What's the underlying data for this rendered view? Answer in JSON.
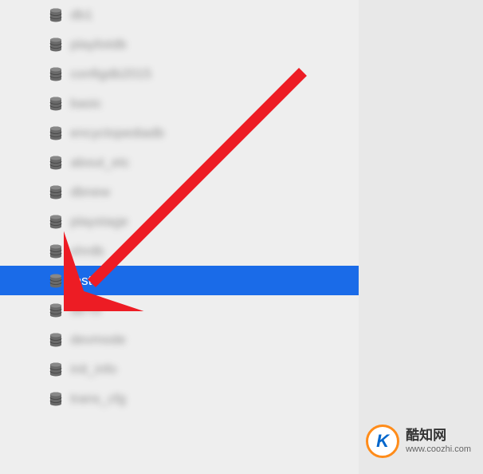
{
  "list": {
    "items": [
      {
        "label": "db1",
        "selected": false,
        "blurred": true
      },
      {
        "label": "playlistdb",
        "selected": false,
        "blurred": true
      },
      {
        "label": "configdb2015",
        "selected": false,
        "blurred": true
      },
      {
        "label": "basic",
        "selected": false,
        "blurred": true
      },
      {
        "label": "encyclopediadb",
        "selected": false,
        "blurred": true
      },
      {
        "label": "about_etc",
        "selected": false,
        "blurred": true
      },
      {
        "label": "dbnew",
        "selected": false,
        "blurred": true
      },
      {
        "label": "playstage",
        "selected": false,
        "blurred": true
      },
      {
        "label": "shrdb",
        "selected": false,
        "blurred": true
      },
      {
        "label": "test",
        "selected": true,
        "blurred": false
      },
      {
        "label": "db-f3",
        "selected": false,
        "blurred": true
      },
      {
        "label": "devmode",
        "selected": false,
        "blurred": true
      },
      {
        "label": "init_info",
        "selected": false,
        "blurred": true
      },
      {
        "label": "trans_cfg",
        "selected": false,
        "blurred": true
      }
    ]
  },
  "watermark": {
    "logo_text": "K",
    "title": "酷知网",
    "url": "www.coozhi.com"
  },
  "colors": {
    "selection": "#1a6be8",
    "arrow": "#ed1c24"
  }
}
